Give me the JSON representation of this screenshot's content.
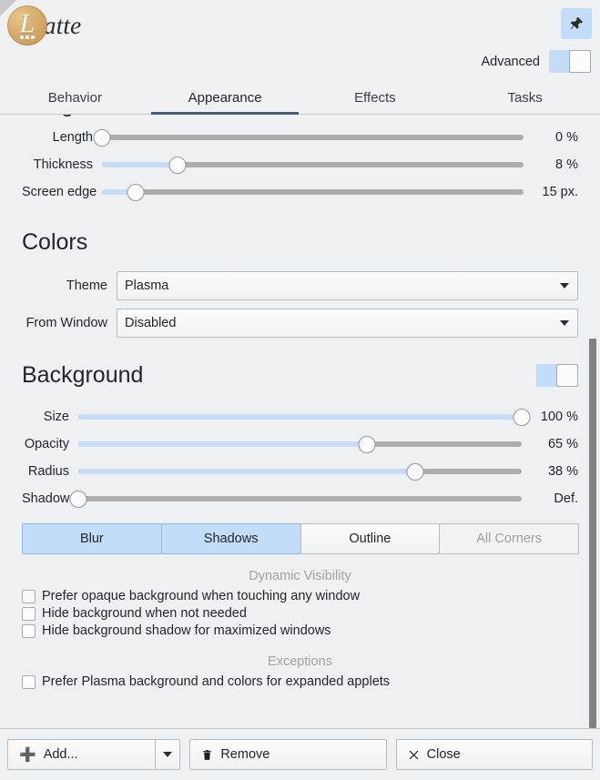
{
  "app": {
    "name": "Latte",
    "logo_letter": "L",
    "logo_rest": "atte",
    "accent": "#c3dcf7",
    "active_tab_underline": "#475a78"
  },
  "header": {
    "pin_icon": "pushpin-icon",
    "advanced_label": "Advanced",
    "advanced_enabled": false
  },
  "tabs": [
    {
      "label": "Behavior",
      "active": false
    },
    {
      "label": "Appearance",
      "active": true
    },
    {
      "label": "Effects",
      "active": false
    },
    {
      "label": "Tasks",
      "active": false
    }
  ],
  "margins": {
    "clipped_heading": "Margins",
    "sliders": [
      {
        "label": "Length",
        "value_text": "0 %",
        "percent": 0,
        "fill_percent": 0
      },
      {
        "label": "Thickness",
        "value_text": "8 %",
        "percent": 18,
        "fill_percent": 18
      },
      {
        "label": "Screen edge",
        "value_text": "15 px.",
        "percent": 8,
        "fill_percent": 8
      }
    ]
  },
  "colors": {
    "heading": "Colors",
    "fields": [
      {
        "label": "Theme",
        "value": "Plasma",
        "icon": "chevron-down-icon"
      },
      {
        "label": "From Window",
        "value": "Disabled",
        "icon": "chevron-down-icon"
      }
    ]
  },
  "background": {
    "heading": "Background",
    "enabled": false,
    "sliders": [
      {
        "label": "Size",
        "value_text": "100 %",
        "percent": 100,
        "fill_percent": 100
      },
      {
        "label": "Opacity",
        "value_text": "65 %",
        "percent": 65,
        "fill_percent": 65
      },
      {
        "label": "Radius",
        "value_text": "38 %",
        "percent": 76,
        "fill_percent": 76
      },
      {
        "label": "Shadow",
        "value_text": "Def.",
        "percent": 0,
        "fill_percent": 0
      }
    ],
    "toggle_buttons": [
      {
        "label": "Blur",
        "state": "on"
      },
      {
        "label": "Shadows",
        "state": "on"
      },
      {
        "label": "Outline",
        "state": "off"
      },
      {
        "label": "All Corners",
        "state": "disabled"
      }
    ],
    "dynamic_visibility_caption": "Dynamic Visibility",
    "dynamic_visibility_options": [
      {
        "label": "Prefer opaque background when touching any window",
        "checked": false
      },
      {
        "label": "Hide background when not needed",
        "checked": false
      },
      {
        "label": "Hide background shadow for maximized windows",
        "checked": false
      }
    ],
    "exceptions_caption": "Exceptions",
    "exceptions_options": [
      {
        "label": "Prefer Plasma background and colors for expanded applets",
        "checked": false
      }
    ]
  },
  "bottom_bar": {
    "add_label": "Add...",
    "add_icon": "plus-icon",
    "add_menu_icon": "chevron-down-icon",
    "remove_label": "Remove",
    "remove_icon": "trash-icon",
    "close_label": "Close",
    "close_icon": "close-x-icon"
  }
}
